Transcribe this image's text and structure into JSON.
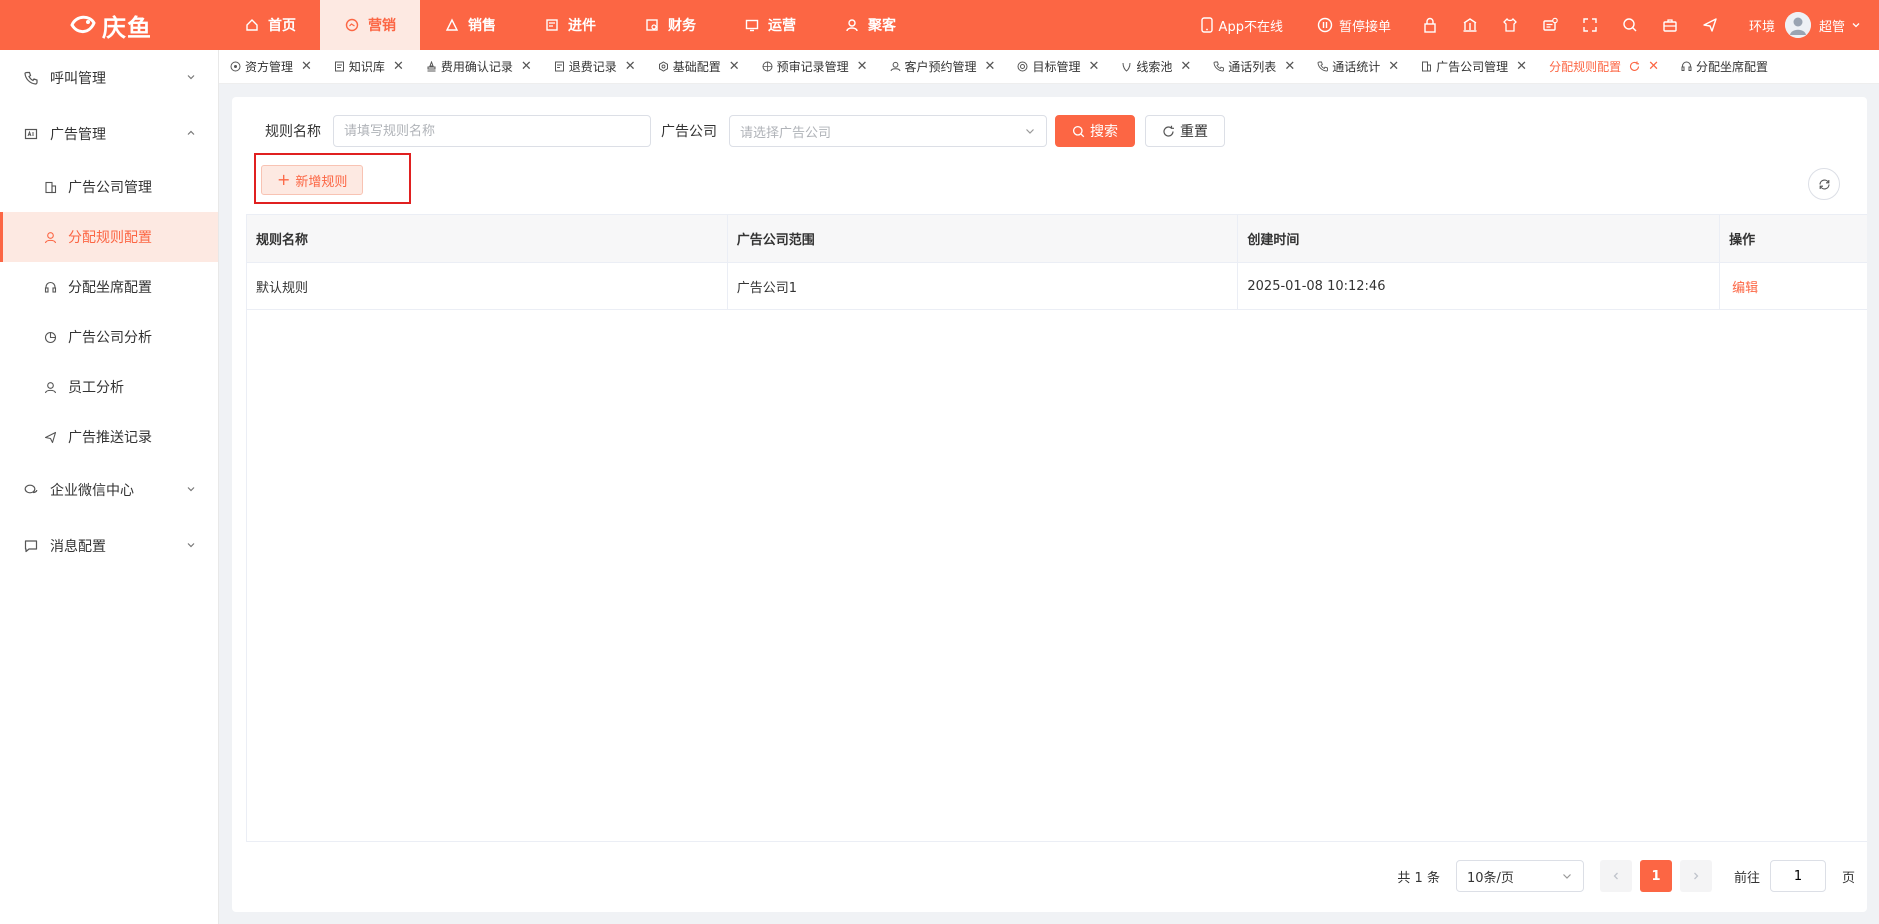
{
  "app": {
    "logo_text": "庆鱼",
    "brand_color": "#fc6644",
    "accent_bg": "#fde9e2"
  },
  "topnav": {
    "items": [
      {
        "label": "首页",
        "icon": "home-icon"
      },
      {
        "label": "营销",
        "icon": "marketing-icon",
        "active": true
      },
      {
        "label": "销售",
        "icon": "sales-icon"
      },
      {
        "label": "进件",
        "icon": "application-icon"
      },
      {
        "label": "财务",
        "icon": "finance-icon"
      },
      {
        "label": "运营",
        "icon": "operations-icon"
      },
      {
        "label": "聚客",
        "icon": "customers-icon"
      }
    ]
  },
  "topright": {
    "app_status": "App不在线",
    "pause_orders": "暂停接单",
    "env": "环境",
    "user": "超管"
  },
  "sidebar": {
    "groups": [
      {
        "label": "呼叫管理",
        "icon": "phone-icon",
        "expanded": false
      },
      {
        "label": "广告管理",
        "icon": "ad-icon",
        "expanded": true
      },
      {
        "label": "企业微信中心",
        "icon": "wechat-icon",
        "expanded": false
      },
      {
        "label": "消息配置",
        "icon": "message-icon",
        "expanded": false
      }
    ],
    "sub_items": [
      {
        "label": "广告公司管理",
        "icon": "building-icon"
      },
      {
        "label": "分配规则配置",
        "icon": "user-icon",
        "active": true
      },
      {
        "label": "分配坐席配置",
        "icon": "headset-icon"
      },
      {
        "label": "广告公司分析",
        "icon": "pie-chart-icon"
      },
      {
        "label": "员工分析",
        "icon": "user-icon"
      },
      {
        "label": "广告推送记录",
        "icon": "send-icon"
      }
    ]
  },
  "tabs": [
    {
      "label": "资方管理"
    },
    {
      "label": "知识库"
    },
    {
      "label": "费用确认记录"
    },
    {
      "label": "退费记录"
    },
    {
      "label": "基础配置"
    },
    {
      "label": "预审记录管理"
    },
    {
      "label": "客户预约管理"
    },
    {
      "label": "目标管理"
    },
    {
      "label": "线索池"
    },
    {
      "label": "通话列表"
    },
    {
      "label": "通话统计"
    },
    {
      "label": "广告公司管理"
    },
    {
      "label": "分配规则配置",
      "active": true
    },
    {
      "label": "分配坐席配置"
    }
  ],
  "filters": {
    "rule_name_label": "规则名称",
    "rule_name_placeholder": "请填写规则名称",
    "company_label": "广告公司",
    "company_placeholder": "请选择广告公司",
    "search_btn": "搜索",
    "reset_btn": "重置"
  },
  "actions": {
    "add_rule": "新增规则"
  },
  "table": {
    "columns": [
      "规则名称",
      "广告公司范围",
      "创建时间",
      "操作"
    ],
    "rows": [
      {
        "name": "默认规则",
        "scope": "广告公司1",
        "created": "2025-01-08 10:12:46",
        "action": "编辑"
      }
    ]
  },
  "pagination": {
    "total": "共 1 条",
    "page_size": "10条/页",
    "current": "1",
    "goto_label": "前往",
    "goto_value": "1",
    "unit": "页"
  }
}
